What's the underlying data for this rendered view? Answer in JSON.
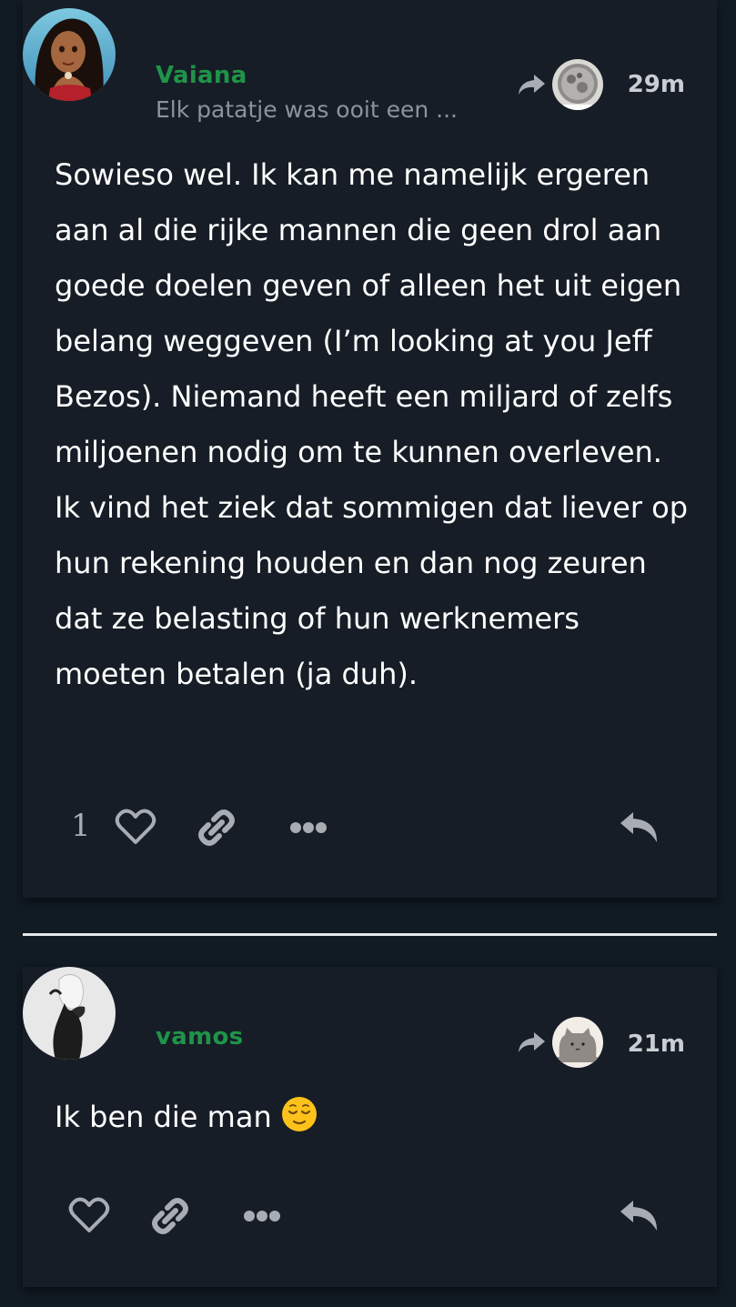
{
  "posts": [
    {
      "username": "Vaiana",
      "topic_snippet": "Elk patatje was ooit een ...",
      "timestamp": "29m",
      "body": "Sowieso wel. Ik kan me namelijk ergeren aan al die rijke mannen die geen drol aan goede doelen geven of alleen het uit eigen belang weggeven (I’m looking at you Jeff Bezos). Niemand heeft een miljard of zelfs miljoenen nodig om te kunnen overleven. Ik vind het ziek dat sommigen dat liever op hun rekening houden en dan nog zeuren dat ze belasting of hun werknemers moeten betalen (ja duh).",
      "like_count": "1"
    },
    {
      "username": "vamos",
      "timestamp": "21m",
      "body": "Ik ben die man",
      "like_count": ""
    }
  ],
  "icons": [
    "reply-indicator-icon",
    "heart-icon",
    "link-icon",
    "more-icon",
    "reply-icon",
    "relieved-face-emoji"
  ],
  "colors": {
    "background": "#111b24",
    "card": "#161d26",
    "username": "#1f9448",
    "muted_text": "#8c939a",
    "icon": "#a7adb3"
  }
}
